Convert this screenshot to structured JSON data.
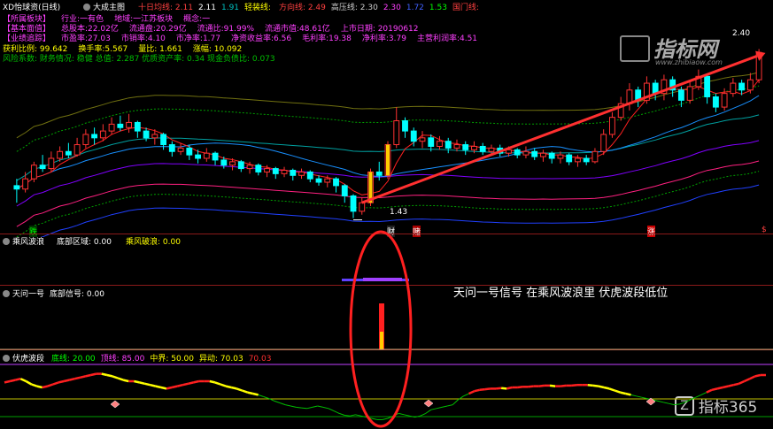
{
  "title_bar": {
    "stock": "XD怡球资(日线)",
    "main_indicator": "大成主图",
    "fields": [
      {
        "t": "十日均线: 2.11",
        "c": "#ff4040"
      },
      {
        "t": "2.11",
        "c": "#ffffff"
      },
      {
        "t": "1.91",
        "c": "#00c0c0"
      },
      {
        "t": "轻装线: ",
        "c": "#ffff00"
      },
      {
        "t": "方向线: 2.49",
        "c": "#ff4040"
      },
      {
        "t": "高压线: 2.30",
        "c": "#cccccc"
      },
      {
        "t": "2.30",
        "c": "#ff40ff"
      },
      {
        "t": "1.72",
        "c": "#4060ff"
      },
      {
        "t": "1.53",
        "c": "#00ff00"
      },
      {
        "t": "国门线: ",
        "c": "#ff4040"
      }
    ]
  },
  "info": {
    "row1": [
      "【所属板块】",
      "行业:一有色",
      "地域:一江苏板块",
      "概念:一"
    ],
    "row2": [
      "【基本面值】",
      "总股本:22.02亿",
      "流通盘:20.29亿",
      "流通比:91.99%",
      "流通市值:48.61亿",
      "上市日期: 20190612"
    ],
    "row3": [
      "【业绩追踪】",
      "市盈率:27.03",
      "市销率:4.10",
      "市净率:1.77",
      "净资收益率:6.56",
      "毛利率:19.38",
      "净利率:3.79",
      "主营利润率:4.51"
    ],
    "row4": [
      "获利比例: 99.642",
      "换手率:5.567",
      "量比: 1.661",
      "涨幅: 10.092"
    ],
    "row5": [
      "风险系数: 财务情况: 稳健  总值: 2.287  优质资产率: 0.34  现金负债比: 0.073"
    ]
  },
  "watermark": {
    "brand": "指标网",
    "site": "www.zhibiaow.com"
  },
  "price_labels": {
    "low": "1.43",
    "high": "2.40"
  },
  "markers": {
    "m1": "跌",
    "m2": "财",
    "m3": "赌",
    "m4": "涨",
    "m5": "$"
  },
  "pane2": {
    "title": "乘风波浪",
    "f1": "底部区域: 0.00",
    "f2": "乘风破浪: 0.00"
  },
  "pane3": {
    "title": "天问一号",
    "f1": "底部信号: 0.00",
    "annotation": "天问一号信号 在乘风波浪里 伏虎波段低位"
  },
  "pane4": {
    "title": "伏虎波段",
    "fields": [
      {
        "t": "底线: 20.00",
        "c": "#00ff00"
      },
      {
        "t": "顶线: 85.00",
        "c": "#ff40ff"
      },
      {
        "t": "中界: 50.00",
        "c": "#ffff00"
      },
      {
        "t": "异动: 70.03",
        "c": "#ffff00"
      },
      {
        "t": "70.03",
        "c": "#ff3030"
      }
    ]
  },
  "logo": {
    "text": "指标365"
  },
  "colors": {
    "up": "#ff3232",
    "down": "#00ffff",
    "ma_red": "#ff2020",
    "ma_blue": "#1890ff",
    "accent": "#ff3030"
  },
  "chart_data": {
    "type": "candlestick",
    "title": "XD怡球资(日线)",
    "ylim": [
      1.35,
      2.5
    ],
    "low_mark": 1.43,
    "high_mark": 2.4,
    "candles": [
      [
        1.62,
        1.6,
        1.66,
        1.52
      ],
      [
        1.6,
        1.66,
        1.7,
        1.58
      ],
      [
        1.66,
        1.74,
        1.76,
        1.64
      ],
      [
        1.74,
        1.72,
        1.8,
        1.7
      ],
      [
        1.72,
        1.78,
        1.82,
        1.7
      ],
      [
        1.78,
        1.82,
        1.85,
        1.76
      ],
      [
        1.82,
        1.8,
        1.87,
        1.78
      ],
      [
        1.8,
        1.86,
        1.9,
        1.79
      ],
      [
        1.86,
        1.92,
        1.95,
        1.84
      ],
      [
        1.92,
        1.9,
        1.96,
        1.86
      ],
      [
        1.9,
        1.94,
        1.98,
        1.88
      ],
      [
        1.94,
        1.98,
        2.02,
        1.92
      ],
      [
        1.98,
        1.96,
        2.03,
        1.94
      ],
      [
        1.96,
        1.99,
        2.04,
        1.93
      ],
      [
        1.99,
        1.94,
        2.0,
        1.9
      ],
      [
        1.94,
        1.9,
        1.96,
        1.88
      ],
      [
        1.9,
        1.92,
        1.95,
        1.86
      ],
      [
        1.92,
        1.86,
        1.93,
        1.83
      ],
      [
        1.86,
        1.82,
        1.88,
        1.79
      ],
      [
        1.82,
        1.84,
        1.87,
        1.8
      ],
      [
        1.84,
        1.8,
        1.86,
        1.77
      ],
      [
        1.8,
        1.78,
        1.83,
        1.75
      ],
      [
        1.78,
        1.81,
        1.84,
        1.76
      ],
      [
        1.81,
        1.77,
        1.82,
        1.74
      ],
      [
        1.77,
        1.74,
        1.79,
        1.72
      ],
      [
        1.74,
        1.76,
        1.78,
        1.71
      ],
      [
        1.76,
        1.72,
        1.77,
        1.7
      ],
      [
        1.72,
        1.74,
        1.76,
        1.69
      ],
      [
        1.74,
        1.7,
        1.75,
        1.68
      ],
      [
        1.7,
        1.72,
        1.74,
        1.67
      ],
      [
        1.72,
        1.69,
        1.73,
        1.66
      ],
      [
        1.69,
        1.71,
        1.73,
        1.67
      ],
      [
        1.71,
        1.68,
        1.72,
        1.65
      ],
      [
        1.68,
        1.7,
        1.72,
        1.66
      ],
      [
        1.7,
        1.66,
        1.71,
        1.64
      ],
      [
        1.66,
        1.64,
        1.68,
        1.62
      ],
      [
        1.64,
        1.66,
        1.68,
        1.61
      ],
      [
        1.66,
        1.62,
        1.67,
        1.58
      ],
      [
        1.62,
        1.56,
        1.63,
        1.52
      ],
      [
        1.56,
        1.47,
        1.57,
        1.43
      ],
      [
        1.47,
        1.52,
        1.55,
        1.45
      ],
      [
        1.52,
        1.7,
        1.72,
        1.5
      ],
      [
        1.7,
        1.68,
        1.76,
        1.65
      ],
      [
        1.68,
        1.86,
        1.88,
        1.66
      ],
      [
        1.86,
        2.0,
        2.08,
        1.84
      ],
      [
        2.0,
        1.94,
        2.02,
        1.9
      ],
      [
        1.94,
        1.88,
        1.96,
        1.85
      ],
      [
        1.88,
        1.9,
        1.94,
        1.84
      ],
      [
        1.9,
        1.85,
        1.92,
        1.82
      ],
      [
        1.85,
        1.88,
        1.91,
        1.83
      ],
      [
        1.88,
        1.84,
        1.9,
        1.81
      ],
      [
        1.84,
        1.86,
        1.89,
        1.82
      ],
      [
        1.86,
        1.83,
        1.88,
        1.8
      ],
      [
        1.83,
        1.85,
        1.88,
        1.81
      ],
      [
        1.85,
        1.82,
        1.87,
        1.8
      ],
      [
        1.82,
        1.84,
        1.86,
        1.8
      ],
      [
        1.84,
        1.81,
        1.86,
        1.79
      ],
      [
        1.81,
        1.83,
        1.85,
        1.79
      ],
      [
        1.83,
        1.8,
        1.84,
        1.78
      ],
      [
        1.8,
        1.82,
        1.85,
        1.78
      ],
      [
        1.82,
        1.79,
        1.84,
        1.77
      ],
      [
        1.79,
        1.81,
        1.83,
        1.76
      ],
      [
        1.81,
        1.78,
        1.82,
        1.75
      ],
      [
        1.78,
        1.8,
        1.82,
        1.75
      ],
      [
        1.8,
        1.76,
        1.81,
        1.74
      ],
      [
        1.76,
        1.78,
        1.8,
        1.73
      ],
      [
        1.78,
        1.76,
        1.8,
        1.74
      ],
      [
        1.76,
        1.82,
        1.84,
        1.75
      ],
      [
        1.82,
        1.92,
        1.95,
        1.8
      ],
      [
        1.92,
        2.02,
        2.05,
        1.9
      ],
      [
        2.02,
        2.1,
        2.14,
        2.0
      ],
      [
        2.1,
        2.18,
        2.22,
        2.06
      ],
      [
        2.18,
        2.12,
        2.2,
        2.08
      ],
      [
        2.12,
        2.22,
        2.26,
        2.1
      ],
      [
        2.22,
        2.16,
        2.24,
        2.12
      ],
      [
        2.16,
        2.24,
        2.27,
        2.12
      ],
      [
        2.24,
        2.18,
        2.26,
        2.14
      ],
      [
        2.18,
        2.12,
        2.2,
        2.08
      ],
      [
        2.12,
        2.2,
        2.23,
        2.1
      ],
      [
        2.2,
        2.26,
        2.3,
        2.18
      ],
      [
        2.26,
        2.14,
        2.27,
        2.1
      ],
      [
        2.14,
        2.08,
        2.16,
        2.05
      ],
      [
        2.08,
        2.16,
        2.19,
        2.06
      ],
      [
        2.16,
        2.22,
        2.25,
        2.14
      ],
      [
        2.22,
        2.18,
        2.24,
        2.15
      ],
      [
        2.18,
        2.24,
        2.28,
        2.16
      ],
      [
        2.24,
        2.4,
        2.42,
        2.22
      ]
    ],
    "trend_line": {
      "from": [
        40,
        1.52
      ],
      "to": [
        86,
        2.4
      ]
    },
    "osc": [
      68,
      70,
      72,
      74,
      70,
      65,
      62,
      60,
      62,
      65,
      68,
      70,
      72,
      74,
      76,
      78,
      80,
      82,
      82,
      80,
      78,
      75,
      72,
      70,
      70,
      68,
      66,
      64,
      62,
      60,
      58,
      60,
      62,
      64,
      66,
      68,
      70,
      70,
      70,
      68,
      65,
      62,
      60,
      58,
      55,
      52,
      50,
      48,
      45,
      42,
      38,
      35,
      32,
      30,
      28,
      27,
      26,
      28,
      30,
      28,
      26,
      22,
      18,
      15,
      14,
      16,
      14,
      12,
      10,
      8,
      8,
      10,
      14,
      18,
      16,
      14,
      12,
      14,
      18,
      24,
      26,
      28,
      30,
      32,
      40,
      46,
      50,
      54,
      56,
      57,
      58,
      58,
      59,
      58,
      60,
      60,
      61,
      61,
      62,
      62,
      63,
      63,
      62,
      62,
      63,
      63,
      64,
      64,
      64,
      63,
      62,
      60,
      58,
      55,
      52,
      50,
      48,
      46,
      44,
      42,
      40,
      38,
      36,
      34,
      32,
      33,
      36,
      40,
      44,
      48,
      52,
      56,
      58,
      60,
      62,
      64,
      66,
      70,
      74,
      78,
      80,
      80
    ]
  }
}
